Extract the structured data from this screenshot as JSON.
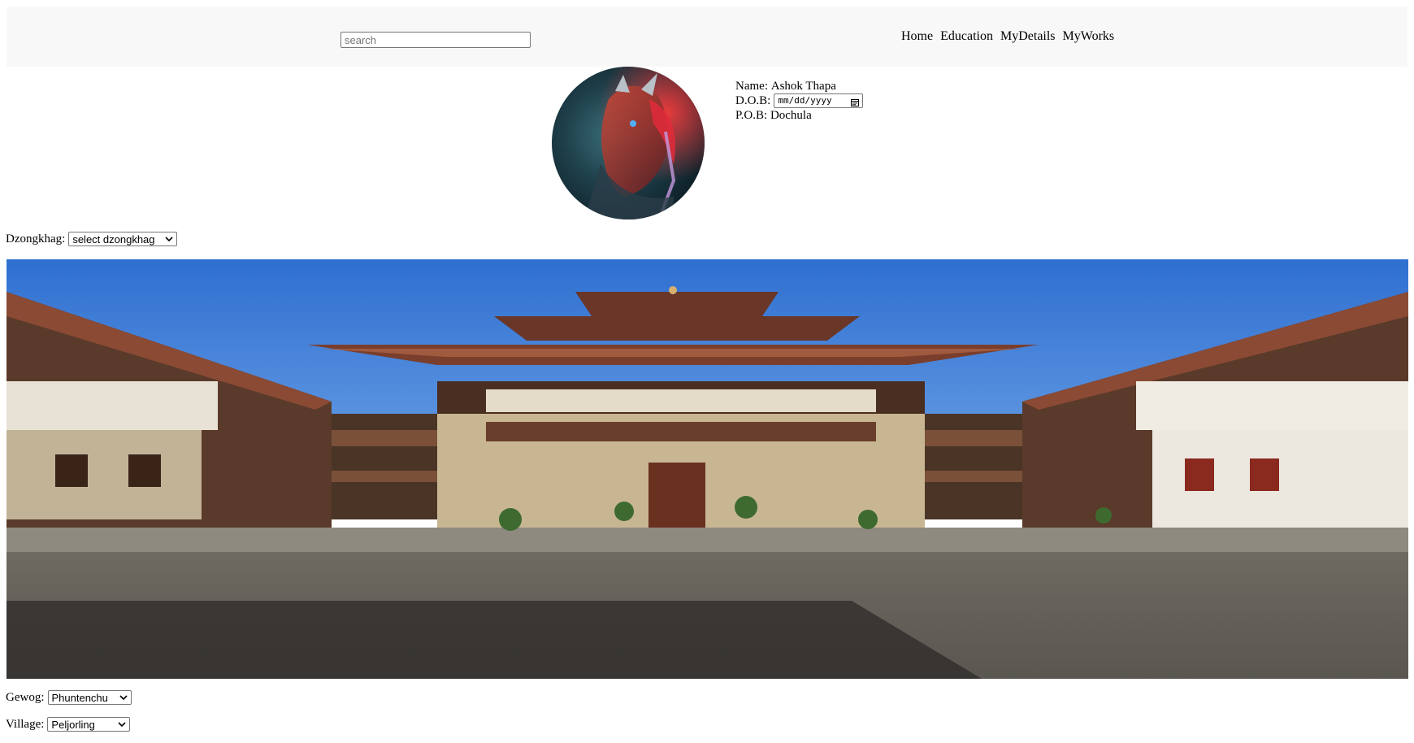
{
  "header": {
    "search_placeholder": "search",
    "nav": [
      "Home",
      "Education",
      "MyDetails",
      "MyWorks"
    ]
  },
  "profile": {
    "name_label": "Name:",
    "name_value": "Ashok Thapa",
    "dob_label": "D.O.B:",
    "dob_placeholder": "mm/dd/yyyy",
    "pob_label": "P.O.B:",
    "pob_value": "Dochula"
  },
  "dzongkhag": {
    "label": "Dzongkhag:",
    "selected": "select dzongkhag"
  },
  "gewog": {
    "label": "Gewog:",
    "selected": "Phuntenchu"
  },
  "village": {
    "label": "Village:",
    "selected": "Peljorling"
  },
  "colors": {
    "header_bg": "#f8f8f8",
    "sky": "#3f7fd6",
    "roof": "#6b3a2a",
    "wall": "#c8b89a",
    "courtyard": "#5e5a54"
  },
  "icons": {
    "calendar": "calendar-icon",
    "chevron": "chevron-down-icon"
  }
}
